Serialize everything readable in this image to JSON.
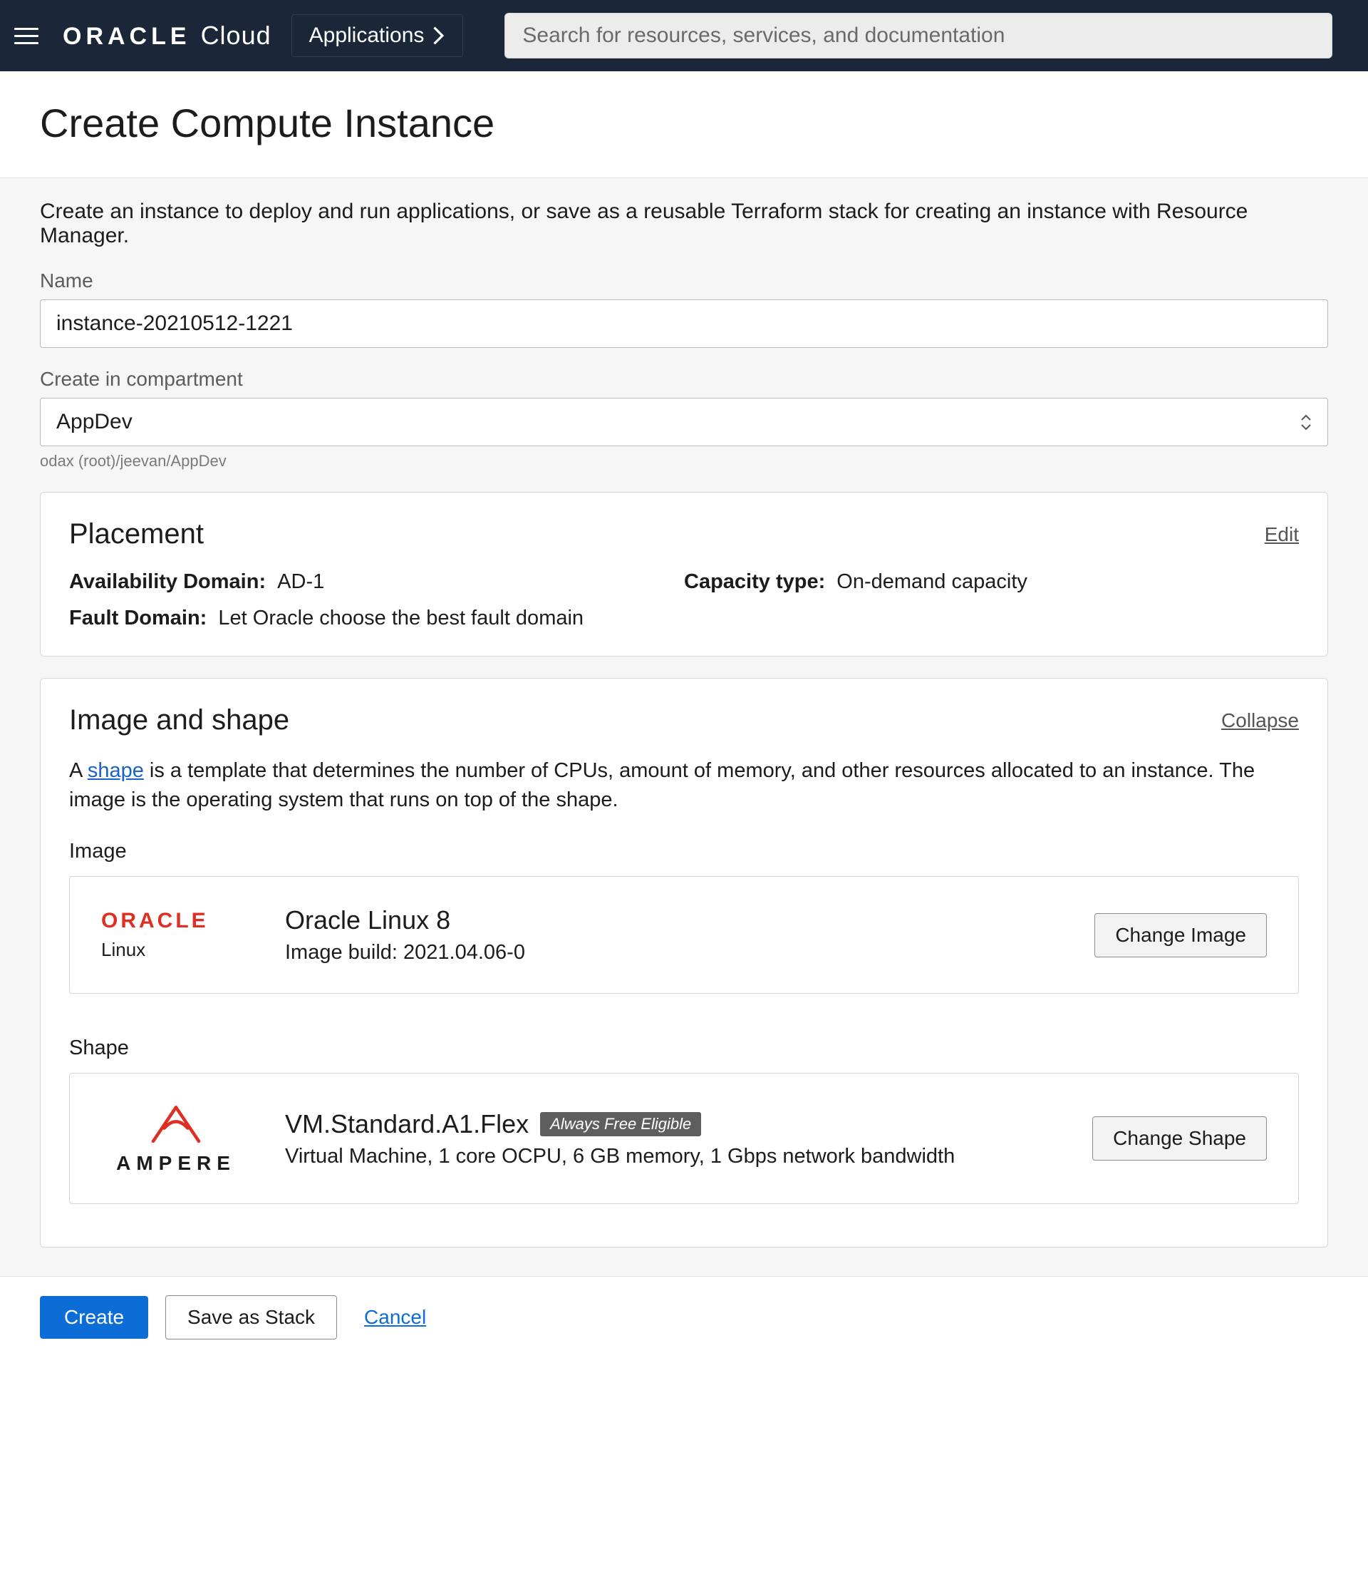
{
  "header": {
    "brand_name": "ORACLE",
    "brand_suffix": "Cloud",
    "applications_label": "Applications",
    "search_placeholder": "Search for resources, services, and documentation"
  },
  "page": {
    "title": "Create Compute Instance",
    "intro": "Create an instance to deploy and run applications, or save as a reusable Terraform stack for creating an instance with Resource Manager."
  },
  "form": {
    "name_label": "Name",
    "name_value": "instance-20210512-1221",
    "compartment_label": "Create in compartment",
    "compartment_value": "AppDev",
    "compartment_breadcrumb": "odax (root)/jeevan/AppDev"
  },
  "placement": {
    "title": "Placement",
    "edit_label": "Edit",
    "availability_domain_label": "Availability Domain:",
    "availability_domain_value": "AD-1",
    "capacity_type_label": "Capacity type:",
    "capacity_type_value": "On-demand capacity",
    "fault_domain_label": "Fault Domain:",
    "fault_domain_value": "Let Oracle choose the best fault domain"
  },
  "image_shape": {
    "title": "Image and shape",
    "collapse_label": "Collapse",
    "desc_prefix": "A ",
    "desc_link": "shape",
    "desc_suffix": " is a template that determines the number of CPUs, amount of memory, and other resources allocated to an instance. The image is the operating system that runs on top of the shape.",
    "image_label": "Image",
    "image": {
      "logo_main": "ORACLE",
      "logo_sub": "Linux",
      "name": "Oracle Linux 8",
      "build": "Image build: 2021.04.06-0",
      "change_label": "Change Image"
    },
    "shape_label": "Shape",
    "shape": {
      "logo_text": "AMPERE",
      "name": "VM.Standard.A1.Flex",
      "badge": "Always Free Eligible",
      "spec": "Virtual Machine, 1 core OCPU, 6 GB memory, 1 Gbps network bandwidth",
      "change_label": "Change Shape"
    }
  },
  "footer": {
    "create_label": "Create",
    "save_stack_label": "Save as Stack",
    "cancel_label": "Cancel"
  }
}
